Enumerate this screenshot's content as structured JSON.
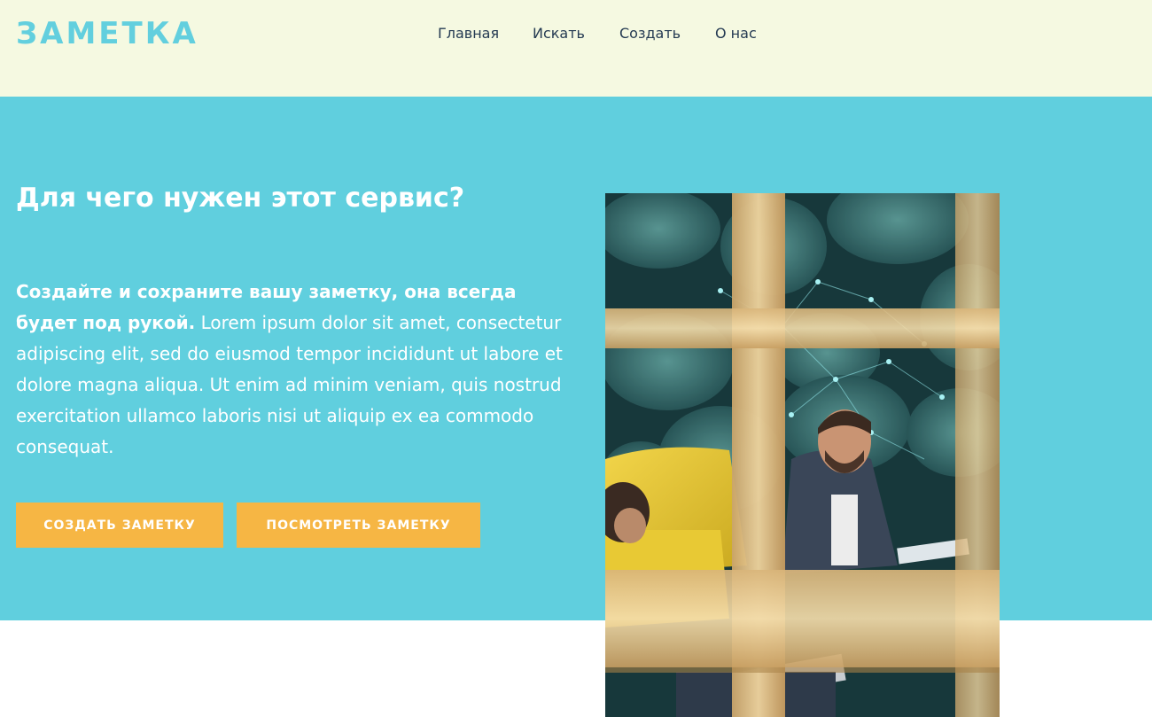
{
  "header": {
    "logo": "ЗАМЕТКА",
    "nav": [
      {
        "label": "Главная"
      },
      {
        "label": "Искать"
      },
      {
        "label": "Создать"
      },
      {
        "label": "О нас"
      }
    ]
  },
  "hero": {
    "title": "Для чего нужен этот сервис?",
    "lead_bold": "Создайте и сохраните вашу заметку, она всегда будет под рукой.",
    "lead_text": " Lorem ipsum dolor sit amet, consectetur adipiscing elit, sed do eiusmod tempor incididunt ut labore et dolore magna aliqua. Ut enim ad minim veniam, quis nostrud exercitation ullamco laboris nisi ut aliquip ex ea commodo consequat.",
    "buttons": {
      "create": "СОЗДАТЬ ЗАМЕТКУ",
      "view": "ПОСМОТРЕТЬ ЗАМЕТКУ"
    }
  },
  "colors": {
    "header_bg": "#f5f9e1",
    "accent": "#60cfde",
    "button": "#f6b644",
    "nav_text": "#243a52"
  }
}
